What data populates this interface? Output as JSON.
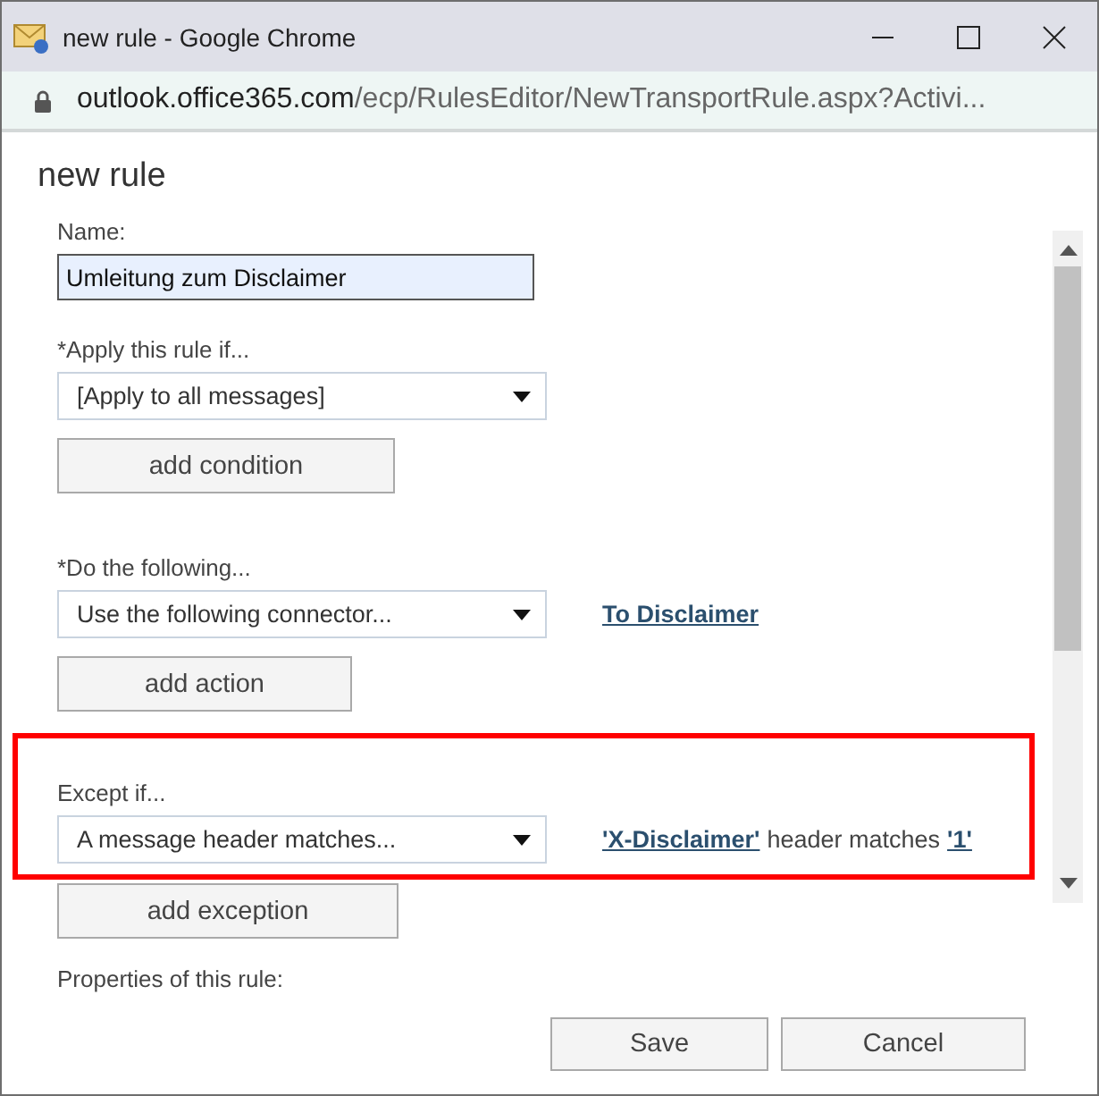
{
  "window": {
    "title": "new rule - Google Chrome"
  },
  "address": {
    "host": "outlook.office365.com",
    "path": "/ecp/RulesEditor/NewTransportRule.aspx?Activi..."
  },
  "dialog": {
    "title": "new rule"
  },
  "name_field": {
    "label": "Name:",
    "value": "Umleitung zum Disclaimer"
  },
  "sections": [
    {
      "label": "*Apply this rule if...",
      "dropdown": "[Apply to all messages]",
      "button": "add condition",
      "highlighted": false
    },
    {
      "label": "*Do the following...",
      "dropdown": "Use the following connector...",
      "detail": [
        {
          "kind": "link",
          "text": "To Disclaimer"
        }
      ],
      "button": "add action",
      "highlighted": false
    },
    {
      "label": "Except if...",
      "dropdown": "A message header matches...",
      "detail": [
        {
          "kind": "link",
          "text": "'X-Disclaimer'"
        },
        {
          "kind": "text",
          "text": "header matches"
        },
        {
          "kind": "link",
          "text": "'1'"
        }
      ],
      "button": "add exception",
      "highlighted": true
    }
  ],
  "properties_label": "Properties of this rule:",
  "buttons": [
    "Save",
    "Cancel"
  ]
}
